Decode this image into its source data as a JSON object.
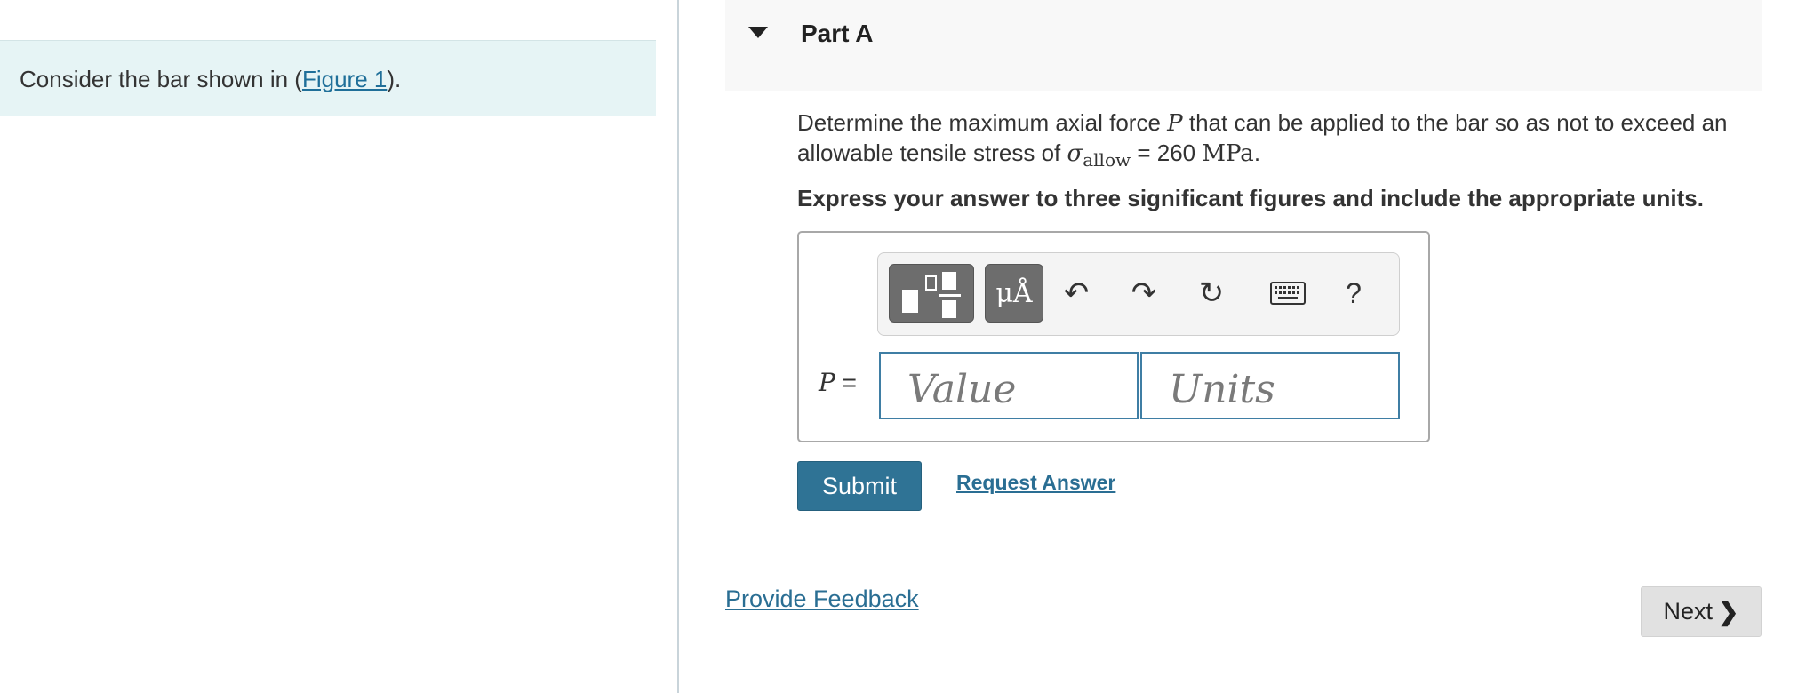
{
  "intro": {
    "text_before": "Consider the bar shown in (",
    "figure_link": "Figure 1",
    "text_after": ")."
  },
  "part": {
    "title": "Part A"
  },
  "question": {
    "line_prefix": "Determine the maximum axial force ",
    "var_P": "P",
    "line_mid": " that can be applied to the bar so as not to exceed an allowable tensile stress of ",
    "sigma": "σ",
    "sigma_sub": "allow",
    "equals_value": " = 260 ",
    "unit": "MPa",
    "period": "."
  },
  "instruction": "Express your answer to three significant figures and include the appropriate units.",
  "toolbar": {
    "units_button": "μÅ",
    "undo_icon": "↶",
    "redo_icon": "↷",
    "reset_icon": "↻",
    "help_label": "?"
  },
  "answer": {
    "var_label": "P",
    "equals": " =",
    "value_placeholder": "Value",
    "units_placeholder": "Units"
  },
  "actions": {
    "submit_label": "Submit",
    "request_answer_label": "Request Answer",
    "provide_feedback_label": "Provide Feedback",
    "next_label": "Next"
  }
}
